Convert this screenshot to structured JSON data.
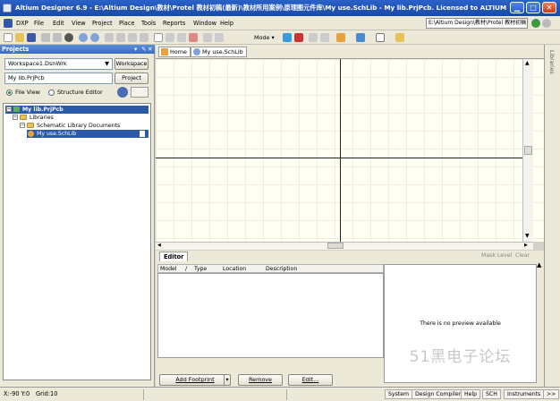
{
  "window": {
    "title": "Altium Designer 6.9 - E:\\Altium Design\\教材\\Protel 教材初稿(最新)\\教材所用案例\\原理图元件库\\My use.SchLib - My lib.PrjPcb. Licensed to ALTIUM"
  },
  "menu": {
    "items": [
      "DXP",
      "File",
      "Edit",
      "View",
      "Project",
      "Place",
      "Tools",
      "Reports",
      "Window",
      "Help"
    ],
    "path_combo": "E:\\Altium Design\\教材\\Protel 教材初稿"
  },
  "toolbar": {
    "mode_label": "Mode ▾"
  },
  "projects": {
    "header": "Projects",
    "workspace_combo": "Workspace1.DsnWrk",
    "workspace_button": "Workspace",
    "project_field": "My lib.PrjPcb",
    "project_button": "Project",
    "file_view": "File View",
    "structure_editor": "Structure Editor",
    "tree": [
      {
        "label": "My lib.PrjPcb"
      },
      {
        "label": "Libraries"
      },
      {
        "label": "Schematic Library Documents"
      },
      {
        "label": "My use.SchLib"
      }
    ]
  },
  "doc_tabs": {
    "home": "Home",
    "schlib": "My use.SchLib"
  },
  "right_panel": {
    "label": "Libraries"
  },
  "editor": {
    "tab": "Editor",
    "mask_level": "Mask Level",
    "clear": "Clear",
    "columns": [
      "Model",
      "/",
      "Type",
      "Location",
      "Description"
    ],
    "preview_text": "There is no preview available",
    "watermark": "51黑电子论坛",
    "add_footprint": "Add Footprint",
    "remove": "Remove",
    "edit": "Edit..."
  },
  "status": {
    "coords": "X:-90 Y:0",
    "grid": "Grid:10",
    "buttons": [
      "System",
      "Design Compiler",
      "Help",
      "SCH",
      "Instruments",
      ">>"
    ]
  },
  "colors": {
    "title_bar": "#1f52b4",
    "tree_selection": "#2b5aa8",
    "sheet": "#fffff4"
  }
}
